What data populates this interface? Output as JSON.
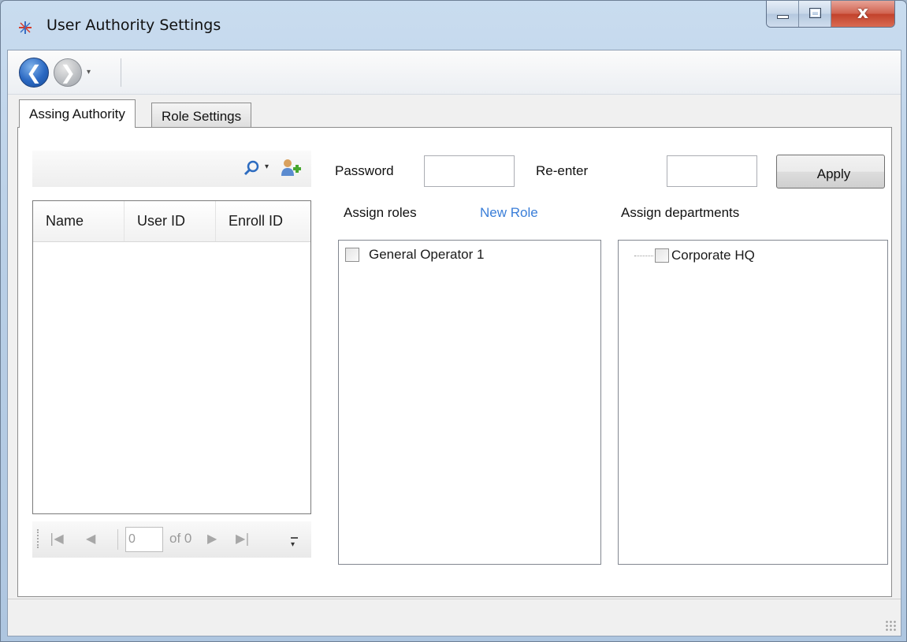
{
  "window": {
    "title": "User Authority Settings",
    "close_glyph": "x"
  },
  "nav": {
    "back_icon": "back-arrow-icon",
    "forward_icon": "forward-arrow-icon",
    "back_glyph": "❮",
    "forward_glyph": "❯",
    "dropdown_glyph": "▾"
  },
  "tabs": [
    {
      "label": "Assing Authority",
      "active": true
    },
    {
      "label": "Role Settings",
      "active": false
    }
  ],
  "search": {
    "value": "",
    "placeholder": "",
    "dropdown_glyph": "▾"
  },
  "user_grid": {
    "columns": [
      "Name",
      "User ID",
      "Enroll ID"
    ],
    "rows": []
  },
  "pager": {
    "first_glyph": "|◀",
    "prev_glyph": "◀",
    "current_page": "0",
    "of_text": "of 0",
    "next_glyph": "▶",
    "last_glyph": "▶|"
  },
  "credentials": {
    "password_label": "Password",
    "password_value": "",
    "reenter_label": "Re-enter",
    "reenter_value": "",
    "apply_label": "Apply"
  },
  "roles": {
    "label": "Assign roles",
    "new_role_link": "New Role",
    "items": [
      {
        "label": "General Operator 1",
        "checked": false
      }
    ]
  },
  "departments": {
    "label": "Assign departments",
    "items": [
      {
        "label": "Corporate HQ",
        "checked": false
      }
    ]
  },
  "colors": {
    "link": "#3a7ed8",
    "back_button": "#2a68c2",
    "title_bar": "#b9cfe6",
    "close_button": "#c2412b"
  }
}
